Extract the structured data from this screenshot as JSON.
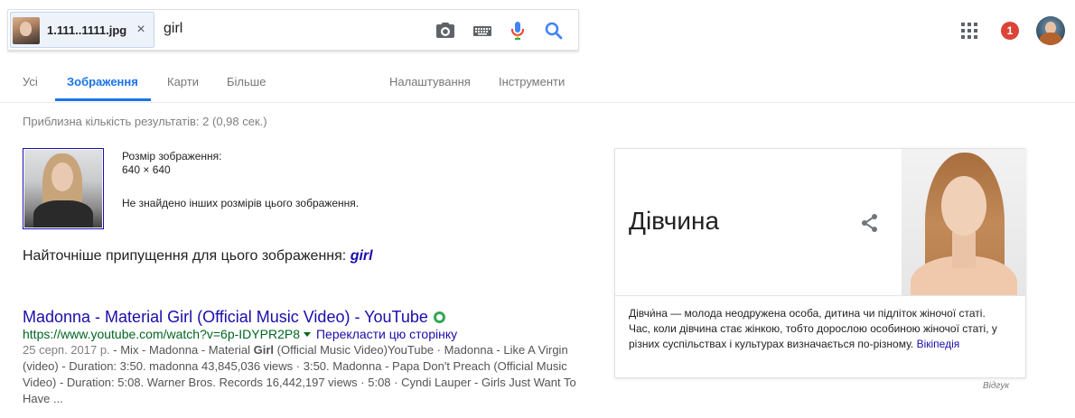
{
  "search": {
    "image_chip_name": "1.111..1111.jpg",
    "image_chip_close": "×",
    "query": "girl",
    "icons": [
      "camera-icon",
      "keyboard-icon",
      "microphone-icon",
      "search-icon"
    ]
  },
  "header": {
    "notifications_count": "1"
  },
  "tabs": {
    "all": "Усі",
    "images": "Зображення",
    "maps": "Карти",
    "more": "Більше",
    "settings": "Налаштування",
    "tools": "Інструменти"
  },
  "results": {
    "stats": "Приблизна кількість результатів: 2 (0,98 сек.)",
    "image_size_label": "Розмір зображення:",
    "image_size_value": "640 × 640",
    "no_other_sizes": "Не знайдено інших розмірів цього зображення.",
    "best_guess_prefix": "Найточніше припущення для цього зображення:",
    "best_guess_link": "girl"
  },
  "result1": {
    "title": "Madonna - Material Girl (Official Music Video) - YouTube",
    "url": "https://www.youtube.com/watch?v=6p-IDYPR2P8",
    "translate": "Перекласти цю сторінку",
    "date": "25 серп. 2017 р.",
    "snippet_a": " - Mix - Madonna - Material ",
    "snippet_bold": "Girl",
    "snippet_b": " (Official Music Video)YouTube · Madonna - Like A Virgin (video) - Duration: 3:50. madonna 43,845,036 views · 3:50. Madonna - Papa Don't Preach (Official Music Video) - Duration: 5:08. Warner Bros. Records 16,442,197 views · 5:08 · Cyndi Lauper - Girls Just Want To Have ..."
  },
  "knowledge_panel": {
    "title": "Дівчина",
    "description": "Дівчи́на — молода неодружена особа, дитина чи підліток жіночої статі. Час, коли дівчина стає жінкою, тобто дорослою особиною жіночої статі, у різних суспільствах і культурах визначається по-різному.",
    "wiki_link": "Вікіпедія",
    "feedback": "Відгук"
  }
}
